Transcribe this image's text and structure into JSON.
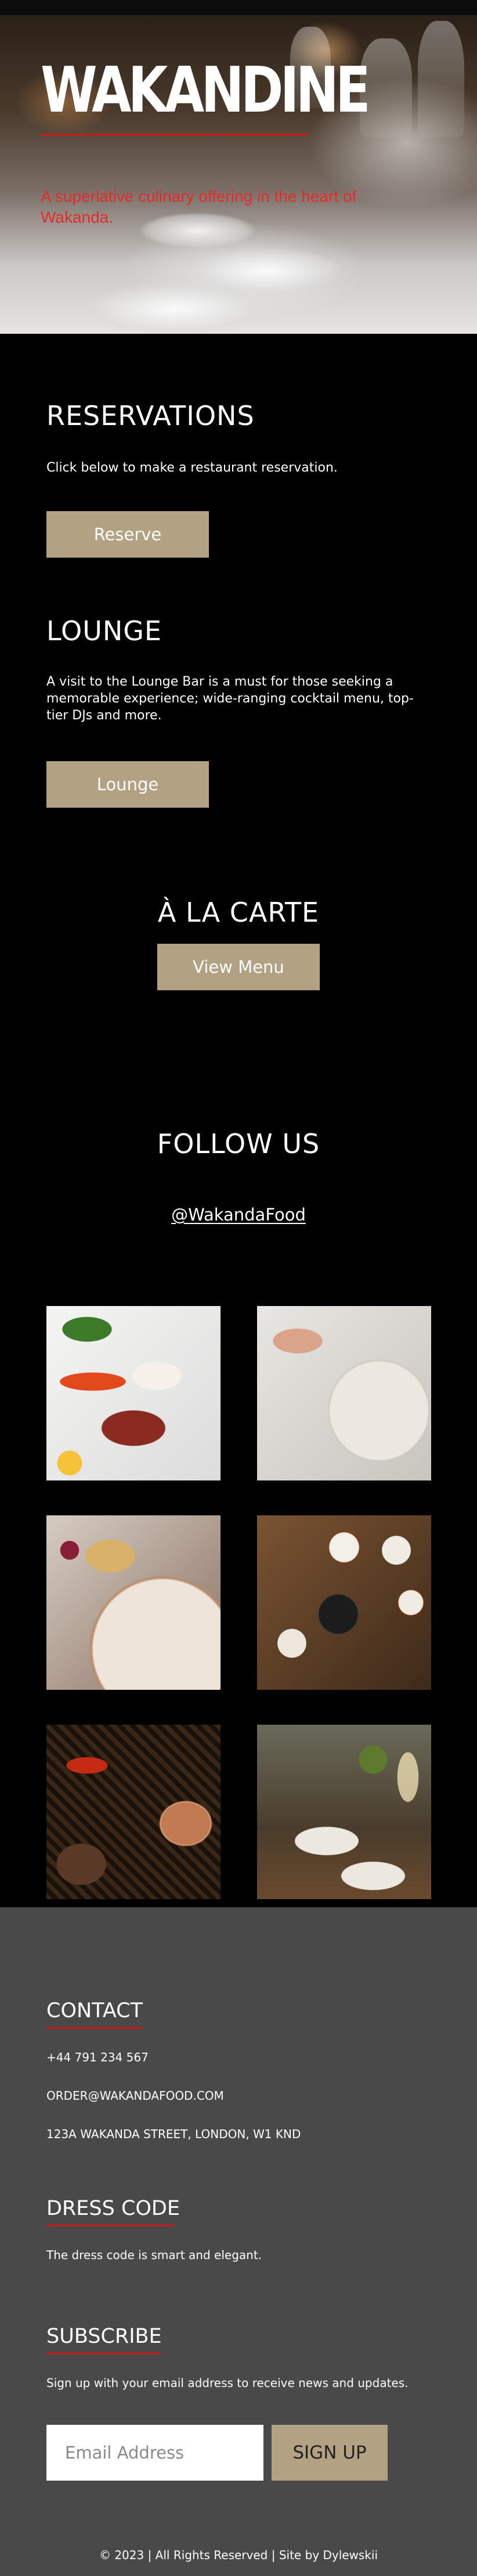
{
  "hero": {
    "title": "WAKANDINE",
    "tagline": "A superlative culinary offering in the heart of Wakanda."
  },
  "reservations": {
    "heading": "RESERVATIONS",
    "text": "Click below to make a restaurant reservation.",
    "button_label": "Reserve"
  },
  "lounge": {
    "heading": "LOUNGE",
    "text": "A visit to the Lounge Bar is a must for those seeking a memorable experience; wide-ranging cocktail menu, top-tier DJs and more.",
    "button_label": "Lounge"
  },
  "carte": {
    "heading": "À LA CARTE",
    "button_label": "View Menu"
  },
  "follow": {
    "heading": "FOLLOW US",
    "handle": "@WakandaFood"
  },
  "gallery": {
    "images": [
      "steak-plate-photo",
      "plated-dish-photo",
      "salad-plate-photo",
      "bibimbap-table-photo",
      "grilled-meat-photo",
      "table-setting-photo"
    ]
  },
  "footer": {
    "contact_heading": "CONTACT",
    "phone": "+44 791 234 567",
    "email": "ORDER@WAKANDAFOOD.COM",
    "address": "123A WAKANDA STREET, LONDON, W1 KND",
    "dress_heading": "DRESS CODE",
    "dress_text": "The dress code is smart and elegant.",
    "subscribe_heading": "SUBSCRIBE",
    "subscribe_text": "Sign up with your email address to receive news and updates.",
    "email_placeholder": "Email Address",
    "signup_label": "SIGN UP",
    "copyright": "© 2023 | All Rights Reserved | Site by Dylewskii"
  },
  "colors": {
    "background": "#000000",
    "accent_button": "#b3a184",
    "accent_red": "#d01818",
    "footer_background": "#494949"
  }
}
